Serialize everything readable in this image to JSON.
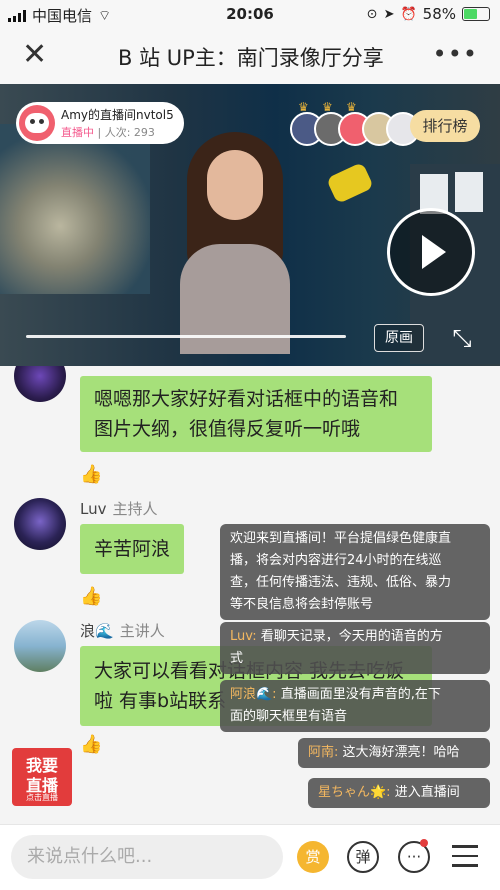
{
  "status_bar": {
    "carrier": "中国电信",
    "time": "20:06",
    "battery": "58%",
    "battery_level": 0.58
  },
  "header": {
    "close_icon": "close-icon",
    "title": "B 站 UP主：南门录像厅分享",
    "more_icon": "more-icon"
  },
  "video": {
    "anchor": {
      "name": "Amy的直播间nvtol5",
      "status": "直播中",
      "separator": " | ",
      "viewers_label": "人次: 293"
    },
    "rank_label": "排行榜",
    "quality_label": "原画",
    "play_icon": "play-icon",
    "fullscreen_icon": "fullscreen-icon"
  },
  "messages": [
    {
      "text_line1": "嗯嗯那大家好好看对话框中的语音和",
      "text_line2": "图片大纲，很值得反复听一听哦"
    },
    {
      "name": "Luv",
      "role": "主持人",
      "text": "辛苦阿浪"
    },
    {
      "name": "浪🌊",
      "role": "主讲人",
      "text_line1": "大家可以看看对话框内容 我先去吃饭",
      "text_line2": "啦 有事b站联系"
    }
  ],
  "notices": [
    {
      "line1": "欢迎来到直播间！平台提倡绿色健康直",
      "line2": "播，将会对内容进行24小时的在线巡",
      "line3": "查，任何传播违法、违规、低俗、暴力",
      "line4": "等不良信息将会封停账号"
    },
    {
      "who": "Luv:",
      "line1": " 看聊天记录，今天用的语音的方",
      "line2": "式"
    },
    {
      "who": "阿浪🌊:",
      "line1": " 直播画面里没有声音的,在下",
      "line2": "面的聊天框里有语音"
    },
    {
      "who": "阿南:",
      "text": " 这大海好漂亮！哈哈"
    },
    {
      "who": "星ちゃん🌟:",
      "text": " 进入直播间"
    }
  ],
  "cta": {
    "line1": "我要",
    "line2": "直播",
    "line3": "点击直播"
  },
  "bottom_bar": {
    "input_placeholder": "来说点什么吧...",
    "tip_label": "赏",
    "danmu_label": "弹",
    "messages_icon": "chat-bubble-icon",
    "menu_icon": "menu-icon"
  }
}
